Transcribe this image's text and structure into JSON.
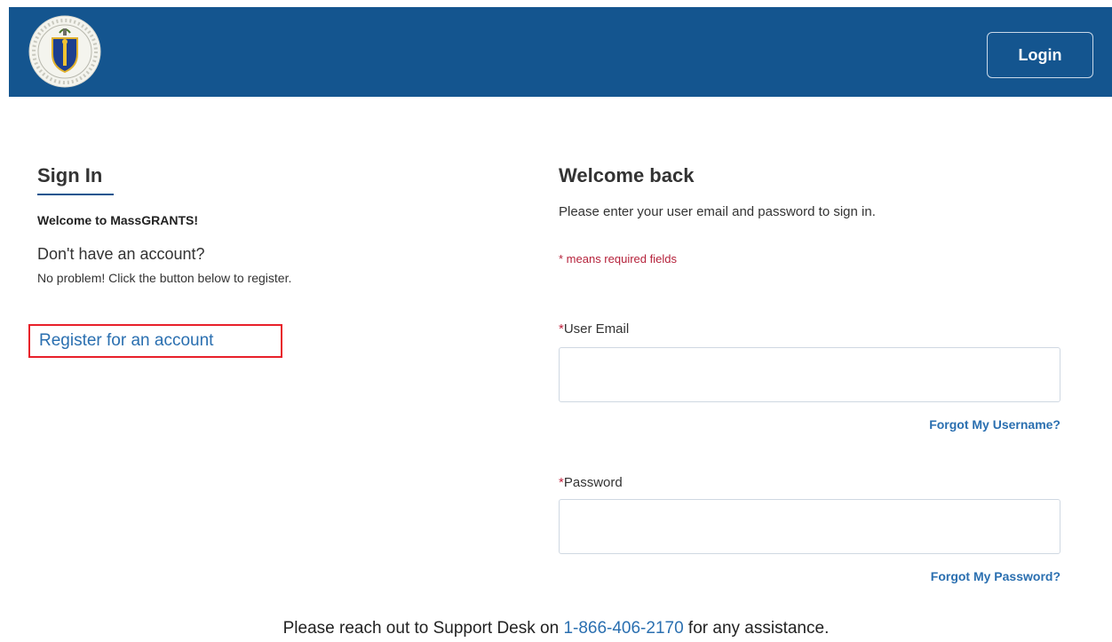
{
  "header": {
    "logo_icon": "commonwealth-seal-icon",
    "login_label": "Login",
    "background_color": "#14558f"
  },
  "signin": {
    "title": "Sign In",
    "welcome": "Welcome to MassGRANTS!",
    "no_account": "Don't have an account?",
    "no_problem": "No problem! Click the button below to register.",
    "register_label": "Register for an account"
  },
  "form": {
    "title": "Welcome back",
    "instructions": "Please enter your user email and password to sign in.",
    "required_note": "* means required fields",
    "email_label": "User Email",
    "email_value": "",
    "forgot_username": "Forgot My Username?",
    "password_label": "Password",
    "password_value": "",
    "forgot_password": "Forgot My Password?",
    "required_marker": "*"
  },
  "footer": {
    "prefix": "Please reach out to Support Desk on ",
    "phone": "1-866-406-2170",
    "suffix": " for any assistance."
  },
  "colors": {
    "brand_blue": "#14558f",
    "link_blue": "#2a6fb0",
    "required_red": "#c0233f",
    "highlight_red": "#e8202a"
  }
}
